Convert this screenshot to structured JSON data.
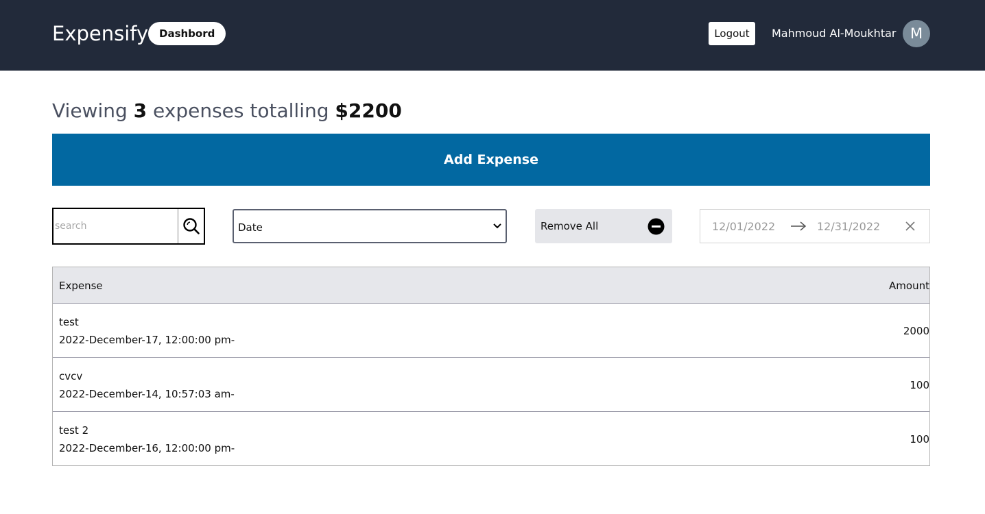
{
  "header": {
    "brand": "Expensify",
    "dashboard_label": "Dashbord",
    "logout_label": "Logout",
    "user_name": "Mahmoud Al-Moukhtar",
    "avatar_initial": "M",
    "background_color": "#222a3a"
  },
  "summary": {
    "prefix": "Viewing ",
    "count": "3",
    "middle": " expenses totalling ",
    "total": "$2200"
  },
  "add_expense_label": "Add Expense",
  "add_expense_color": "#0268a1",
  "filters": {
    "search_placeholder": "search",
    "search_value": "",
    "sort_selected": "Date",
    "remove_all_label": "Remove All",
    "start_date": "12/01/2022",
    "end_date": "12/31/2022"
  },
  "table": {
    "columns": [
      "Expense",
      "Amount"
    ],
    "rows": [
      {
        "description": "test",
        "date": "2022-December-17, 12:00:00 pm-",
        "amount": "2000"
      },
      {
        "description": "cvcv",
        "date": "2022-December-14, 10:57:03 am-",
        "amount": "100"
      },
      {
        "description": "test 2",
        "date": "2022-December-16, 12:00:00 pm-",
        "amount": "100"
      }
    ]
  },
  "icons": {
    "search": "search-icon",
    "sort": "chevron-down-icon",
    "remove_all": "minus-circle-icon",
    "date_arrow": "arrow-right-icon",
    "date_clear": "close-icon"
  }
}
